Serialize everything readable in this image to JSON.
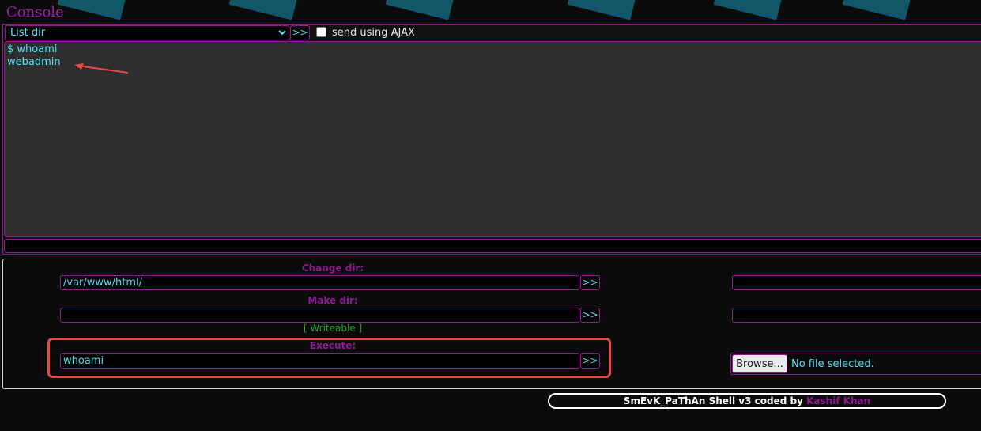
{
  "console": {
    "title": "Console",
    "select_value": "List dir",
    "submit_label": ">>",
    "ajax_label": "send using AJAX",
    "ajax_checked": false,
    "output_lines": [
      "$ whoami",
      "webadmin"
    ]
  },
  "tools": {
    "change_dir": {
      "label": "Change dir:",
      "value": "/var/www/html/",
      "button": ">>"
    },
    "make_dir": {
      "label": "Make dir:",
      "value": "",
      "button": ">>"
    },
    "writeable": "[ Writeable ]",
    "execute": {
      "label": "Execute:",
      "value": "whoami",
      "button": ">>"
    },
    "upload": {
      "browse_label": "Browse...",
      "file_status": "No file selected."
    }
  },
  "footer": {
    "text": "SmEvK_PaThAn Shell v3 coded by",
    "author": "Kashif Khan"
  },
  "colors": {
    "accent": "#8d1a92",
    "text": "#4ee0f0",
    "writeable": "#20a020",
    "highlight": "#e84848"
  }
}
